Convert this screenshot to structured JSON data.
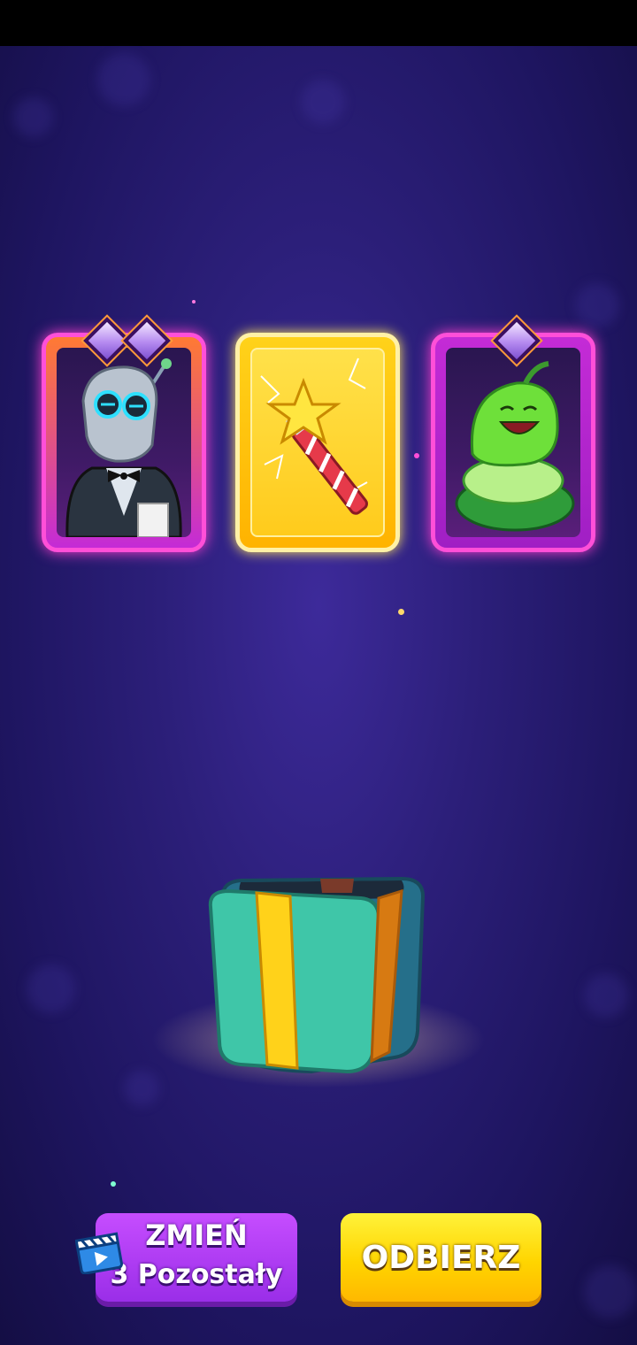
{
  "buttons": {
    "change_label": "ZMIEŃ",
    "change_remaining": "3 Pozostały",
    "collect_label": "ODBIERZ"
  },
  "rewards": [
    {
      "icon": "robot-waiter-icon",
      "rarity_gems": 2
    },
    {
      "icon": "magic-wand-icon",
      "rarity_gems": 0
    },
    {
      "icon": "green-worm-icon",
      "rarity_gems": 1
    }
  ],
  "colors": {
    "background": "#2c1f7a",
    "epic_card_border": "#ff4fd8",
    "special_card": "#ffd21a",
    "change_button": "#b23ef5",
    "collect_button": "#ffd500",
    "chest": "#3fc6a8"
  }
}
